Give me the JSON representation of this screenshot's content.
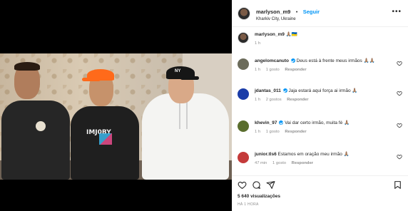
{
  "post": {
    "username": "marlyson_m9",
    "follow_label": "Seguir",
    "location": "Kharkiv City, Ukraine",
    "more_icon": "more-horizontal-icon",
    "caption_text": "🙏🏽🇺🇦",
    "caption_time": "1 h"
  },
  "video": {
    "shirt_text": "IMJ0BY"
  },
  "comments": [
    {
      "user": "angelomcanuto",
      "text": "Deus está à frente meus irmãos 🙏🏽🙏🏽",
      "time": "1 h",
      "likes": "1 gosto",
      "reply": "Responder",
      "verified": true,
      "avatar_color": "#6b6b5a"
    },
    {
      "user": "jdantas_011",
      "text": "Jaja estará aqui força ai irmão 🙏🏽",
      "time": "1 h",
      "likes": "2 gostos",
      "reply": "Responder",
      "verified": true,
      "avatar_color": "#1a3ca8"
    },
    {
      "user": "khevin_97",
      "text": "Vai dar certo irmão, muita fé 🙏🏽",
      "time": "1 h",
      "likes": "1 gosto",
      "reply": "Responder",
      "verified": true,
      "avatar_color": "#5a6e2e"
    },
    {
      "user": "junior.tls6",
      "text": "Estamos em oração meu irmão 🙏🏽",
      "time": "47 min",
      "likes": "1 gosto",
      "reply": "Responder",
      "verified": false,
      "avatar_color": "#c43a3a"
    }
  ],
  "stats": {
    "views": "5 640 visualizações",
    "posted_ago": "HÁ 1 HORA"
  },
  "colors": {
    "accent": "#0095f6",
    "text": "#262626",
    "muted": "#8e8e8e"
  }
}
